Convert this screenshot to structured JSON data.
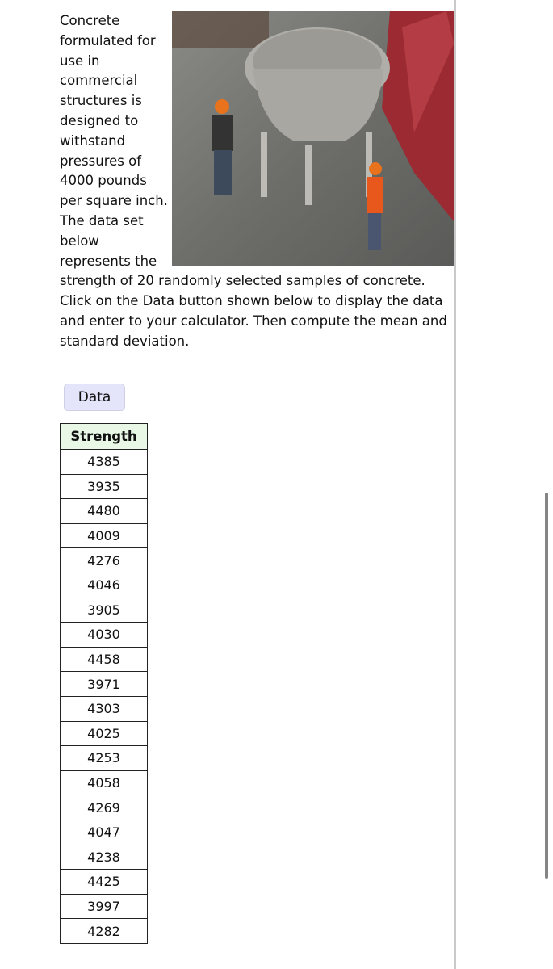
{
  "question": {
    "text": "Concrete formulated for use in commercial structures is designed to withstand pressures of 4000 pounds per square inch. The data set below represents the strength of 20 randomly selected samples of concrete. Click on the Data button shown below to display the data and enter to your calculator. Then compute the mean and standard deviation.",
    "image": "concrete-bucket-construction-photo"
  },
  "data_button": {
    "label": "Data"
  },
  "table": {
    "header": "Strength",
    "header_color": "#e9f8e6",
    "values": [
      "4385",
      "3935",
      "4480",
      "4009",
      "4276",
      "4046",
      "3905",
      "4030",
      "4458",
      "3971",
      "4303",
      "4025",
      "4253",
      "4058",
      "4269",
      "4047",
      "4238",
      "4425",
      "3997",
      "4282"
    ]
  },
  "colors": {
    "button_bg": "#e4e4fa"
  }
}
